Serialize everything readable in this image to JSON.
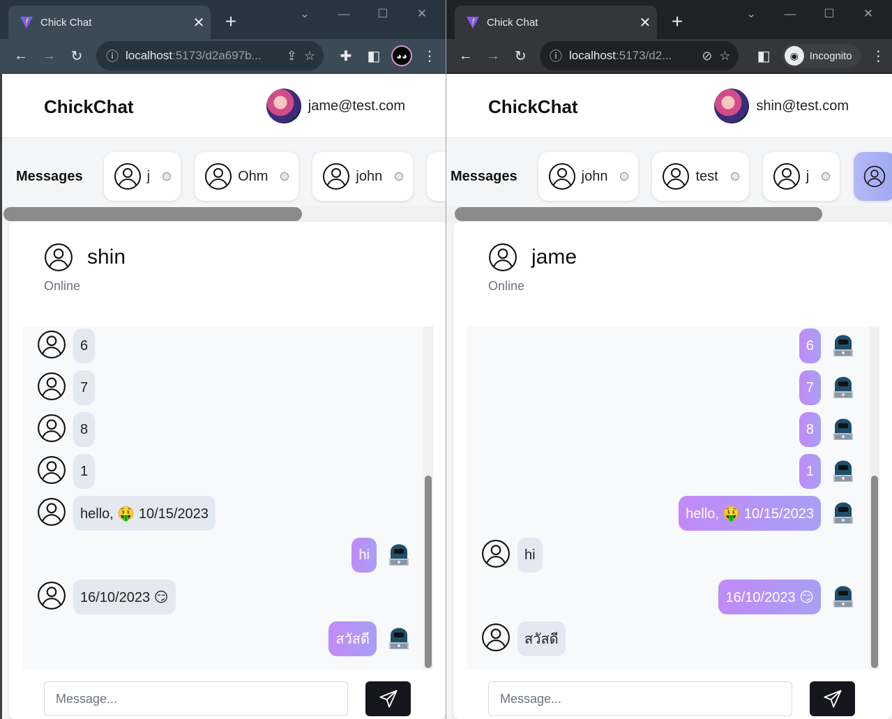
{
  "left": {
    "tab_title": "Chick Chat",
    "url_host": "localhost",
    "url_path": ":5173/d2a697b...",
    "brand": "ChickChat",
    "user_email": "jame@test.com",
    "contacts_title": "Messages",
    "contacts": [
      "j",
      "Ohm",
      "john"
    ],
    "chat_name": "shin",
    "chat_status": "Online",
    "messages": [
      {
        "dir": "in",
        "text": "6"
      },
      {
        "dir": "in",
        "text": "7"
      },
      {
        "dir": "in",
        "text": "8"
      },
      {
        "dir": "in",
        "text": "1"
      },
      {
        "dir": "in",
        "text": "hello, 🤑 10/15/2023"
      },
      {
        "dir": "out",
        "text": "hi"
      },
      {
        "dir": "in",
        "text": "16/10/2023 😏"
      },
      {
        "dir": "out",
        "text": "สวัสดี"
      }
    ],
    "placeholder": "Message..."
  },
  "right": {
    "tab_title": "Chick Chat",
    "url_host": "localhost",
    "url_path": ":5173/d2...",
    "incognito_label": "Incognito",
    "brand": "ChickChat",
    "user_email": "shin@test.com",
    "contacts_title": "Messages",
    "contacts": [
      "john",
      "test",
      "j"
    ],
    "chat_name": "jame",
    "chat_status": "Online",
    "messages": [
      {
        "dir": "out",
        "text": "6"
      },
      {
        "dir": "out",
        "text": "7"
      },
      {
        "dir": "out",
        "text": "8"
      },
      {
        "dir": "out",
        "text": "1"
      },
      {
        "dir": "out",
        "text": "hello, 🤑 10/15/2023"
      },
      {
        "dir": "in",
        "text": "hi"
      },
      {
        "dir": "out",
        "text": "16/10/2023 😏"
      },
      {
        "dir": "in",
        "text": "สวัสดี"
      }
    ],
    "placeholder": "Message..."
  },
  "colors": {
    "outgoing_bubble_start": "#c18af7",
    "outgoing_bubble_end": "#a89ff5",
    "incoming_bubble": "#e4e8f0",
    "send_button": "#16161f"
  },
  "icons": [
    "vite-favicon",
    "back-arrow-icon",
    "forward-arrow-icon",
    "reload-icon",
    "info-icon",
    "share-icon",
    "star-icon",
    "extensions-icon",
    "sidepanel-icon",
    "profile-icon",
    "menu-icon",
    "eye-off-icon",
    "incognito-icon",
    "user-circle-icon",
    "hacker-avatar-icon",
    "send-icon"
  ]
}
